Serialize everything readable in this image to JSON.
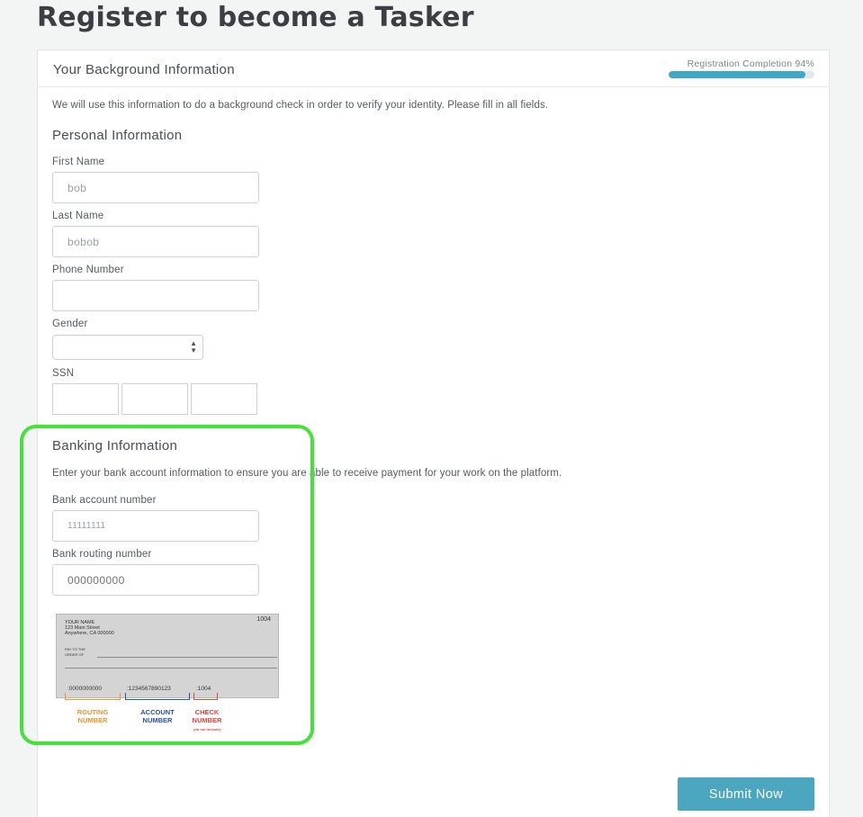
{
  "page": {
    "title": "Register to become a Tasker"
  },
  "panel": {
    "title": "Your Background Information",
    "progress": {
      "label": "Registration Completion 94%",
      "percent": 94
    },
    "intro": "We will use this information to do a background check in order to verify your identity. Please fill in all fields."
  },
  "personal": {
    "title": "Personal Information",
    "first_name": {
      "label": "First Name",
      "value": "bob"
    },
    "last_name": {
      "label": "Last Name",
      "value": "bobob"
    },
    "phone": {
      "label": "Phone Number",
      "value": ""
    },
    "gender": {
      "label": "Gender",
      "value": ""
    },
    "ssn": {
      "label": "SSN"
    }
  },
  "banking": {
    "title": "Banking Information",
    "intro": "Enter your bank account information to ensure you are able to receive payment for your work on the platform.",
    "account": {
      "label": "Bank account number",
      "value": "11111111"
    },
    "routing": {
      "label": "Bank routing number",
      "placeholder": "000000000"
    },
    "check_image": {
      "number": "1004",
      "name": "YOUR NAME",
      "street": "123 Main Street",
      "city": "Anywhere, CA 000000",
      "pay_to": "PAY TO THE",
      "order_of": "ORDER OF",
      "routing_digits": ":0000000000",
      "account_digits": ":1234567890123",
      "check_digits": ":1004",
      "routing_caption_1": "ROUTING",
      "routing_caption_2": "NUMBER",
      "account_caption_1": "ACCOUNT",
      "account_caption_2": "NUMBER",
      "check_caption_1": "CHECK",
      "check_caption_2": "NUMBER",
      "check_caption_3": "(do not include)",
      "colors": {
        "routing": "#f0922b",
        "account": "#2c4fa8",
        "check": "#e0453f"
      }
    }
  },
  "actions": {
    "submit": "Submit Now"
  },
  "colors": {
    "accent": "#4aa7bf",
    "highlight": "#44e23a"
  }
}
